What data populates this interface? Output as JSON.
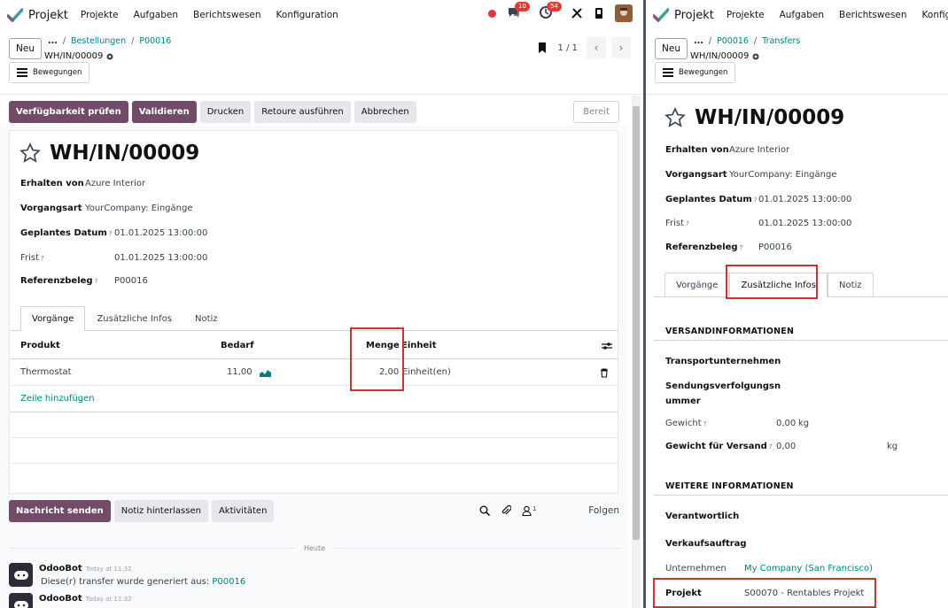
{
  "left": {
    "navbar": {
      "app_name": "Projekt",
      "menu": [
        "Projekte",
        "Aufgaben",
        "Berichtswesen",
        "Konfiguration"
      ],
      "messages_badge": "10",
      "activities_badge": "54"
    },
    "control": {
      "new_label": "Neu",
      "breadcrumb_dots": "...",
      "breadcrumb": [
        "Bestellungen",
        "P00016"
      ],
      "record_name": "WH/IN/00009",
      "moves_label": "Bewegungen",
      "pager": "1 / 1"
    },
    "statusbar": {
      "buttons": [
        "Verfügbarkeit prüfen",
        "Validieren",
        "Drucken",
        "Retoure ausführen",
        "Abbrechen"
      ],
      "state": "Bereit"
    },
    "form": {
      "title": "WH/IN/00009",
      "fields": [
        {
          "label": "Erhalten von",
          "value": "Azure Interior"
        },
        {
          "label": "Vorgangsart",
          "value": "YourCompany: Eingänge"
        },
        {
          "label": "Geplantes Datum",
          "value": "01.01.2025 13:00:00"
        },
        {
          "label": "Frist",
          "value": "01.01.2025 13:00:00"
        },
        {
          "label": "Referenzbeleg",
          "value": "P00016"
        }
      ],
      "tabs": [
        "Vorgänge",
        "Zusätzliche Infos",
        "Notiz"
      ],
      "grid": {
        "headers": [
          "Produkt",
          "Bedarf",
          "Menge",
          "Einheit"
        ],
        "rows": [
          {
            "product": "Thermostat",
            "demand": "11,00",
            "quantity": "2,00",
            "uom": "Einheit(en)"
          }
        ],
        "add_line": "Zeile hinzufügen"
      }
    },
    "chatter": {
      "buttons": [
        "Nachricht senden",
        "Notiz hinterlassen",
        "Aktivitäten"
      ],
      "followers_count": "1",
      "follow_label": "Folgen",
      "today_label": "Heute",
      "messages": [
        {
          "author": "OdooBot",
          "time": "Today at 11:32",
          "body": "Diese(r) transfer wurde generiert aus:",
          "link": "P00016"
        },
        {
          "author": "OdooBot",
          "time": "Today at 11:32"
        }
      ]
    }
  },
  "right": {
    "navbar": {
      "app_name": "Projekt",
      "menu": [
        "Projekte",
        "Aufgaben",
        "Berichtswesen",
        "Konfiguratio"
      ]
    },
    "control": {
      "new_label": "Neu",
      "breadcrumb_dots": "...",
      "breadcrumb": [
        "P00016",
        "Transfers"
      ],
      "record_name": "WH/IN/00009",
      "moves_label": "Bewegungen"
    },
    "form": {
      "title": "WH/IN/00009",
      "fields": [
        {
          "label": "Erhalten von",
          "value": "Azure Interior"
        },
        {
          "label": "Vorgangsart",
          "value": "YourCompany: Eingänge"
        },
        {
          "label": "Geplantes Datum",
          "value": "01.01.2025 13:00:00"
        },
        {
          "label": "Frist",
          "value": "01.01.2025 13:00:00"
        },
        {
          "label": "Referenzbeleg",
          "value": "P00016"
        }
      ],
      "tabs": [
        "Vorgänge",
        "Zusätzliche Infos",
        "Notiz"
      ],
      "shipping": {
        "title": "VERSANDINFORMATIONEN",
        "carrier_label": "Transportunternehmen",
        "tracking_label_1": "Sendungsverfolgungsn",
        "tracking_label_2": "ummer",
        "weight_label": "Gewicht",
        "weight_value": "0,00",
        "weight_unit": "kg",
        "ship_weight_label": "Gewicht für Versand",
        "ship_weight_value": "0,00",
        "ship_weight_unit": "kg"
      },
      "other": {
        "title": "WEITERE INFORMATIONEN",
        "responsible_label": "Verantwortlich",
        "sale_order_label": "Verkaufsauftrag",
        "company_label": "Unternehmen",
        "company_value": "My Company (San Francisco)",
        "project_label": "Projekt",
        "project_value": "S00070 - Rentables Projekt"
      }
    }
  },
  "colors": {
    "primary": "#714b67",
    "link": "#017e84",
    "highlight": "#d32f2f"
  }
}
